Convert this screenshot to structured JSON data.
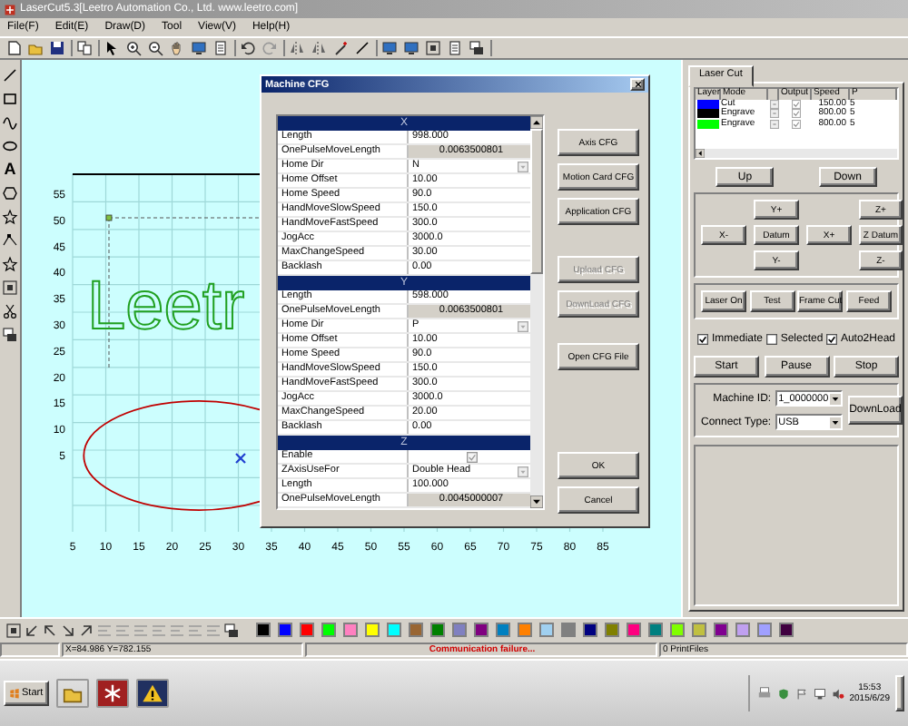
{
  "window": {
    "title": "LaserCut5.3[Leetro Automation Co., Ltd. www.leetro.com]"
  },
  "menu": [
    "File(F)",
    "Edit(E)",
    "Draw(D)",
    "Tool",
    "View(V)",
    "Help(H)"
  ],
  "toolbox": {
    "text_tool": "A"
  },
  "canvas": {
    "x_ticks": [
      "5",
      "10",
      "15",
      "20",
      "25",
      "30",
      "35",
      "40",
      "45",
      "50",
      "55",
      "60",
      "65",
      "70",
      "75",
      "80",
      "85"
    ],
    "y_ticks": [
      "55",
      "50",
      "45",
      "40",
      "35",
      "30",
      "25",
      "20",
      "15",
      "10",
      "5"
    ],
    "design_text": "Leetr"
  },
  "dialog": {
    "title": "Machine CFG",
    "sections": [
      {
        "name": "X",
        "rows": [
          {
            "name": "Length",
            "value": "998.000",
            "kind": "text"
          },
          {
            "name": "OnePulseMoveLength",
            "value": "0.0063500801",
            "kind": "readonly"
          },
          {
            "name": "Home Dir",
            "value": "N",
            "kind": "dropdown"
          },
          {
            "name": "Home Offset",
            "value": "10.00",
            "kind": "text"
          },
          {
            "name": "Home Speed",
            "value": "90.0",
            "kind": "text"
          },
          {
            "name": "HandMoveSlowSpeed",
            "value": "150.0",
            "kind": "text"
          },
          {
            "name": "HandMoveFastSpeed",
            "value": "300.0",
            "kind": "text"
          },
          {
            "name": "JogAcc",
            "value": "3000.0",
            "kind": "text"
          },
          {
            "name": "MaxChangeSpeed",
            "value": "30.00",
            "kind": "text"
          },
          {
            "name": "Backlash",
            "value": "0.00",
            "kind": "text"
          }
        ]
      },
      {
        "name": "Y",
        "rows": [
          {
            "name": "Length",
            "value": "598.000",
            "kind": "text"
          },
          {
            "name": "OnePulseMoveLength",
            "value": "0.0063500801",
            "kind": "readonly"
          },
          {
            "name": "Home Dir",
            "value": "P",
            "kind": "dropdown"
          },
          {
            "name": "Home Offset",
            "value": "10.00",
            "kind": "text"
          },
          {
            "name": "Home Speed",
            "value": "90.0",
            "kind": "text"
          },
          {
            "name": "HandMoveSlowSpeed",
            "value": "150.0",
            "kind": "text"
          },
          {
            "name": "HandMoveFastSpeed",
            "value": "300.0",
            "kind": "text"
          },
          {
            "name": "JogAcc",
            "value": "3000.0",
            "kind": "text"
          },
          {
            "name": "MaxChangeSpeed",
            "value": "20.00",
            "kind": "text"
          },
          {
            "name": "Backlash",
            "value": "0.00",
            "kind": "text"
          }
        ]
      },
      {
        "name": "Z",
        "rows": [
          {
            "name": "Enable",
            "checked": true,
            "kind": "checkbox"
          },
          {
            "name": "ZAxisUseFor",
            "value": "Double Head",
            "kind": "dropdown"
          },
          {
            "name": "Length",
            "value": "100.000",
            "kind": "text"
          },
          {
            "name": "OnePulseMoveLength",
            "value": "0.0045000007",
            "kind": "readonly"
          }
        ]
      }
    ],
    "buttons": [
      {
        "label": "Axis CFG",
        "disabled": false,
        "kind": "top"
      },
      {
        "label": "Motion Card CFG",
        "disabled": false,
        "kind": "top"
      },
      {
        "label": "Application CFG",
        "disabled": false,
        "kind": "top"
      },
      {
        "label": "Upload CFG",
        "disabled": true,
        "kind": "mid"
      },
      {
        "label": "DownLoad CFG",
        "disabled": true,
        "kind": "mid"
      },
      {
        "label": "Open CFG File",
        "disabled": false,
        "kind": "mid"
      },
      {
        "label": "OK",
        "disabled": false,
        "kind": "bottom"
      },
      {
        "label": "Cancel",
        "disabled": false,
        "kind": "bottom"
      }
    ]
  },
  "panel": {
    "tabs": [
      {
        "label": "Laser Cut",
        "selected": true
      }
    ],
    "layer_columns": [
      "Layer",
      "Mode",
      "Output",
      "Speed",
      "P"
    ],
    "layers": [
      {
        "color": "#0000ff",
        "mode": "Cut",
        "output": true,
        "speed": "150.00",
        "power": "5"
      },
      {
        "color": "#000000",
        "mode": "Engrave",
        "output": true,
        "speed": "800.00",
        "power": "5"
      },
      {
        "color": "#00ff00",
        "mode": "Engrave",
        "output": true,
        "speed": "800.00",
        "power": "5"
      }
    ],
    "order_buttons": [
      "Up",
      "Down"
    ],
    "jog": {
      "y_plus": "Y+",
      "z_plus": "Z+",
      "x_minus": "X-",
      "datum": "Datum",
      "x_plus": "X+",
      "z_datum": "Z Datum",
      "y_minus": "Y-",
      "z_minus": "Z-"
    },
    "laser_buttons": [
      "Laser On",
      "Test",
      "Frame Cut",
      "Feed"
    ],
    "options": [
      {
        "label": "Immediate",
        "checked": true
      },
      {
        "label": "Selected",
        "checked": false
      },
      {
        "label": "Auto2Head",
        "checked": true
      }
    ],
    "run_buttons": [
      "Start",
      "Pause",
      "Stop"
    ],
    "machine_id": {
      "label": "Machine ID:",
      "value": "1_0000000"
    },
    "connect_type": {
      "label": "Connect Type:",
      "value": "USB"
    },
    "download": "DownLoad"
  },
  "palette": [
    {
      "color": "#000000"
    },
    {
      "color": "#0000ff"
    },
    {
      "color": "#ff0000"
    },
    {
      "color": "#00ff00"
    },
    {
      "color": "#ff80c0"
    },
    {
      "color": "#ffff00"
    },
    {
      "color": "#00ffff"
    },
    {
      "color": "#996633"
    },
    {
      "color": "#008000"
    },
    {
      "color": "#8080c0"
    },
    {
      "color": "#800080"
    },
    {
      "color": "#0080c0"
    },
    {
      "color": "#ff8000"
    },
    {
      "color": "#a0d0f0"
    },
    {
      "color": "#808080"
    },
    {
      "color": "#000080"
    },
    {
      "color": "#808000"
    },
    {
      "color": "#ff0080"
    },
    {
      "color": "#008080"
    },
    {
      "color": "#80ff00"
    },
    {
      "color": "#c0c040"
    },
    {
      "color": "#800090"
    },
    {
      "color": "#c0a0f0"
    },
    {
      "color": "#a0a0ff"
    },
    {
      "color": "#400040"
    }
  ],
  "status": {
    "position": "X=84.986 Y=782.155",
    "message": "Communication failure...",
    "files": "0 PrintFiles"
  },
  "taskbar": {
    "start": "Start",
    "time": "15:53",
    "date": "2015/6/29"
  }
}
